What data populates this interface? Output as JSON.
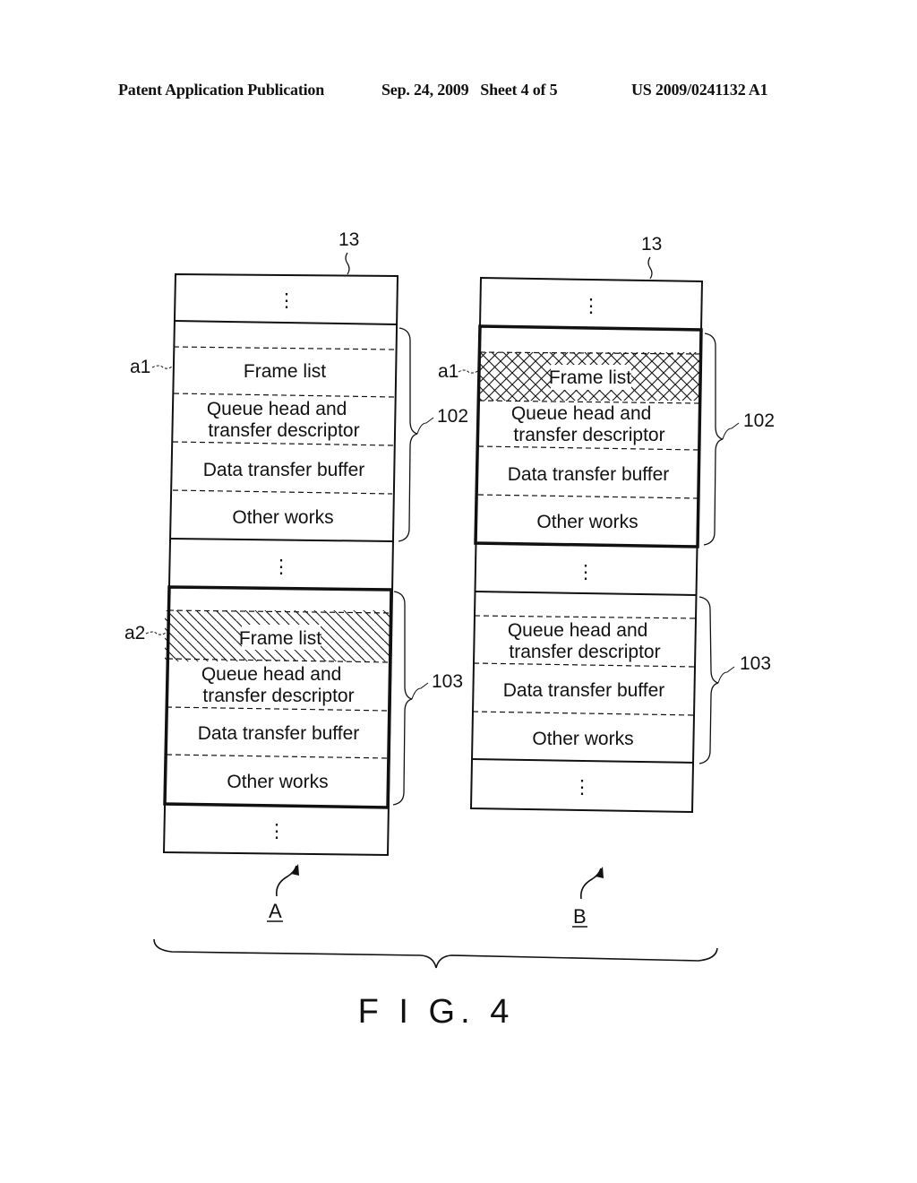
{
  "header": {
    "publication": "Patent Application Publication",
    "date_sheet": "Sep. 24, 2009   Sheet 4 of 5",
    "number": "US 2009/0241132 A1"
  },
  "figure": {
    "label": "F I G. 4",
    "diagrams": [
      {
        "id": "A",
        "label": "A",
        "memory_ref": "13",
        "ellipsis": "⋮",
        "regions": [
          {
            "ref": "102",
            "bold_border": false,
            "cells": [
              {
                "text": "Frame list",
                "pattern": "none",
                "callout": "a1"
              },
              {
                "text": "Queue head and\ntransfer descriptor",
                "pattern": "none"
              },
              {
                "text": "Data transfer buffer",
                "pattern": "none"
              },
              {
                "text": "Other works",
                "pattern": "none"
              }
            ]
          },
          {
            "ref": "103",
            "bold_border": true,
            "cells": [
              {
                "text": "Frame list",
                "pattern": "diagonal-hatch",
                "callout": "a2"
              },
              {
                "text": "Queue head and\ntransfer descriptor",
                "pattern": "none"
              },
              {
                "text": "Data transfer buffer",
                "pattern": "none"
              },
              {
                "text": "Other works",
                "pattern": "none"
              }
            ]
          }
        ]
      },
      {
        "id": "B",
        "label": "B",
        "memory_ref": "13",
        "ellipsis": "⋮",
        "regions": [
          {
            "ref": "102",
            "bold_border": true,
            "cells": [
              {
                "text": "Frame list",
                "pattern": "cross-hatch",
                "callout": "a1"
              },
              {
                "text": "Queue head and\ntransfer descriptor",
                "pattern": "none"
              },
              {
                "text": "Data transfer buffer",
                "pattern": "none"
              },
              {
                "text": "Other works",
                "pattern": "none"
              }
            ]
          },
          {
            "ref": "103",
            "bold_border": false,
            "cells": [
              {
                "text": "Queue head and\ntransfer descriptor",
                "pattern": "none"
              },
              {
                "text": "Data transfer buffer",
                "pattern": "none"
              },
              {
                "text": "Other works",
                "pattern": "none"
              }
            ]
          }
        ]
      }
    ]
  }
}
